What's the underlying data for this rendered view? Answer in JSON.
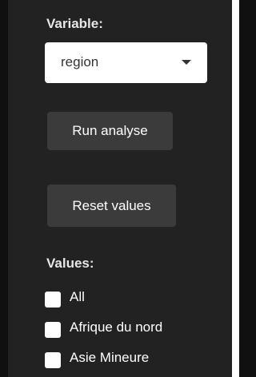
{
  "sidebar": {
    "variable_label": "Variable:",
    "variable_select": {
      "value": "region"
    },
    "run_button_label": "Run analyse",
    "reset_button_label": "Reset values",
    "values_label": "Values:",
    "values_options": [
      {
        "label": "All",
        "checked": false
      },
      {
        "label": "Afrique du nord",
        "checked": false
      },
      {
        "label": "Asie Mineure",
        "checked": false
      }
    ]
  },
  "colors": {
    "panel_bg": "#222222",
    "button_bg": "#3b3b3b",
    "page_bg": "#101010"
  }
}
